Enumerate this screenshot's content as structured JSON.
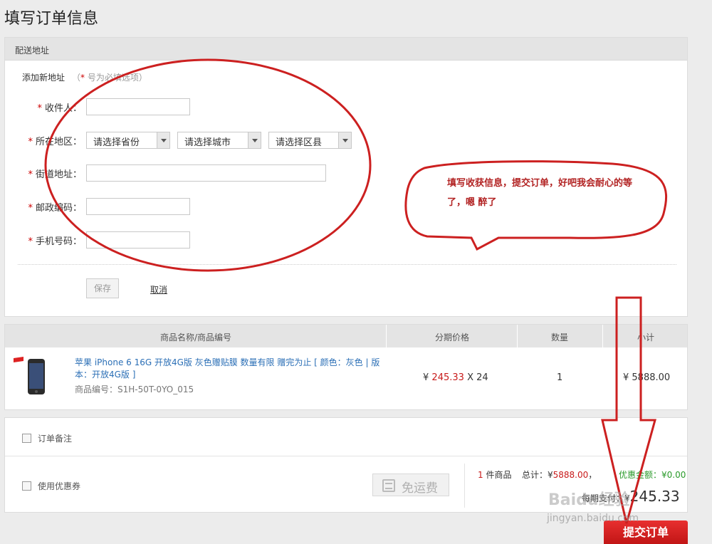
{
  "page": {
    "title": "填写订单信息"
  },
  "address": {
    "header": "配送地址",
    "add_new": "添加新地址",
    "hint_open": "（",
    "hint_star": "*",
    "hint_text": " 号为必填选项）",
    "fields": {
      "recipient": "收件人：",
      "region": "所在地区：",
      "street": "街道地址：",
      "postcode": "邮政编码：",
      "phone": "手机号码："
    },
    "selects": {
      "province": "请选择省份",
      "city": "请选择城市",
      "district": "请选择区县"
    },
    "save": "保存",
    "cancel": "取消"
  },
  "products": {
    "headers": {
      "name": "商品名称/商品编号",
      "price": "分期价格",
      "qty": "数量",
      "subtotal": "小计"
    },
    "item": {
      "name": "苹果 iPhone 6 16G 开放4G版 灰色赠贴膜 数量有限 赠完为止 [ 颜色：灰色 | 版本：开放4G版 ]",
      "code": "商品编号：S1H-50T-0YO_015",
      "price_currency": "¥",
      "price_value": "245.33",
      "price_times": "X 24",
      "qty": "1",
      "subtotal": "¥ 5888.00"
    }
  },
  "bottom": {
    "note_label": "订单备注",
    "coupon_label": "使用优惠券",
    "free_shipping": "免运费",
    "count": "1",
    "count_label": "件商品",
    "total_label": "总计：¥",
    "total_value": "5888.00",
    "comma": "，",
    "discount_label": "优惠金额：¥",
    "discount_value": "0.00",
    "installment_label": "每期支付：¥",
    "installment_value": "245.33",
    "submit": "提交订单"
  },
  "annotation": {
    "callout": "填写收获信息，提交订单，好吧我会耐心的等了，嗯 醉了",
    "color": "#cc2020"
  },
  "watermark": {
    "brand": "Baidu经验",
    "url": "jingyan.baidu.com"
  }
}
